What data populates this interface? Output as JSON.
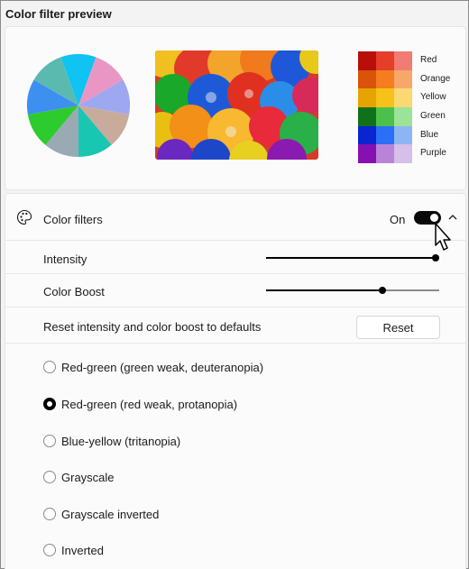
{
  "header": {
    "title": "Color filter preview"
  },
  "preview": {
    "pie_colors": [
      "#0fc3f2",
      "#ea96c4",
      "#9da8f0",
      "#c9ab9b",
      "#19c6b2",
      "#9aaab4",
      "#2ecb2f",
      "#3d8ff0",
      "#5bbab0"
    ],
    "swatches": [
      {
        "label": "Red",
        "colors": [
          "#b80f0a",
          "#e53e29",
          "#f07c74"
        ]
      },
      {
        "label": "Orange",
        "colors": [
          "#d9540a",
          "#f57d1e",
          "#f8a76a"
        ]
      },
      {
        "label": "Yellow",
        "colors": [
          "#e6a400",
          "#f6c21a",
          "#fbd872"
        ]
      },
      {
        "label": "Green",
        "colors": [
          "#10711b",
          "#4cc04a",
          "#9be397"
        ]
      },
      {
        "label": "Blue",
        "colors": [
          "#0a24d0",
          "#2a6ff5",
          "#8db5f5"
        ]
      },
      {
        "label": "Purple",
        "colors": [
          "#8710b0",
          "#b984d8",
          "#d6bfe9"
        ]
      }
    ]
  },
  "filters": {
    "section_label": "Color filters",
    "toggle_state_label": "On",
    "toggle_on": true,
    "intensity_label": "Intensity",
    "intensity_value": 1.0,
    "boost_label": "Color Boost",
    "boost_value": 0.68,
    "reset_label": "Reset intensity and color boost to defaults",
    "reset_button": "Reset",
    "options": [
      {
        "label": "Red-green (green weak, deuteranopia)",
        "selected": false
      },
      {
        "label": "Red-green (red weak, protanopia)",
        "selected": true
      },
      {
        "label": "Blue-yellow (tritanopia)",
        "selected": false
      },
      {
        "label": "Grayscale",
        "selected": false
      },
      {
        "label": "Grayscale inverted",
        "selected": false
      },
      {
        "label": "Inverted",
        "selected": false
      }
    ]
  }
}
